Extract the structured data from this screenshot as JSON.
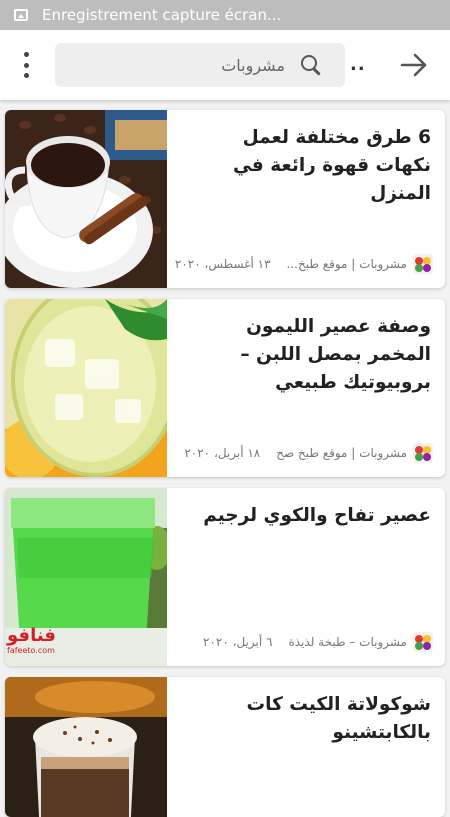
{
  "status_bar": {
    "notification_text": "Enregistrement capture écran..."
  },
  "app_bar": {
    "search_value": "مشروبات",
    "search_placeholder": "مشروبات",
    "overflow_label": ".."
  },
  "articles": [
    {
      "title": "6 طرق مختلفة لعمل نكهات قهوة رائعة في المنزل",
      "category": "مشروبات | موقع طبخ...",
      "date": "١٣ أغسطس، ٢٠٢٠"
    },
    {
      "title": "وصفة عصير الليمون المخمر بمصل اللبن – بروبيوتيك طبيعي",
      "category": "مشروبات | موقع طبخ صح",
      "date": "١٨ أبريل، ٢٠٢٠"
    },
    {
      "title": "عصير تفاح والكوي لرجيم",
      "category": "مشروبات – طبخة لذيذة",
      "date": "٦ أبريل، ٢٠٢٠",
      "watermark": "فنافو",
      "watermark_url": "fafeeto.com"
    },
    {
      "title": "شوكولاتة الكيت كات بالكابتشينو",
      "category": "",
      "date": ""
    }
  ],
  "colors": {
    "status_bar": "#bdbdbd",
    "background": "#f2f2f2",
    "card": "#ffffff",
    "title_text": "#222222",
    "meta_text": "#777777"
  }
}
